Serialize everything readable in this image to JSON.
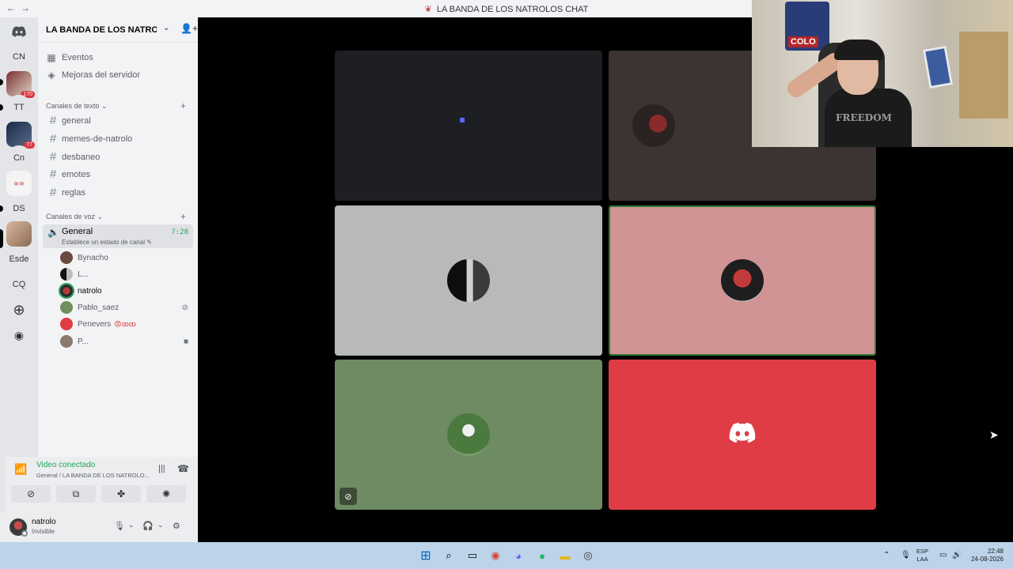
{
  "window": {
    "title": "LA BANDA DE LOS NATROLOS CHAT"
  },
  "guilds": [
    {
      "label": "CN"
    },
    {
      "label": "",
      "badge": "170"
    },
    {
      "label": "TT"
    },
    {
      "label": "",
      "badge": "77"
    },
    {
      "label": "Cn"
    },
    {
      "label": ""
    },
    {
      "label": "DS"
    },
    {
      "label": ""
    },
    {
      "label": "Esde"
    },
    {
      "label": "CQ"
    }
  ],
  "server": {
    "name": "LA BANDA DE LOS NATROL..."
  },
  "top_items": [
    {
      "label": "Eventos"
    },
    {
      "label": "Mejoras del servidor"
    }
  ],
  "text_category": "Canales de texto",
  "text_channels": [
    "general",
    "memes-de-natrolo",
    "desbaneo",
    "emotes",
    "reglas"
  ],
  "voice_category": "Canales de voz",
  "voice_channel": {
    "name": "General",
    "status": "Establece un estado de canal",
    "timer": "7:28"
  },
  "voice_users": [
    {
      "name": "Bynacho",
      "color": "#6b4a3e"
    },
    {
      "name": "L...",
      "color": "#222222"
    },
    {
      "name": "natrolo",
      "color": "#b23b3b"
    },
    {
      "name": "Pablo_saez",
      "color": "#6f8f5e"
    },
    {
      "name": "Penevers",
      "emoji": "😡ꝏꝏ",
      "color": "#e03c45"
    },
    {
      "name": "P...",
      "color": "#8b7a6f"
    }
  ],
  "voice_panel": {
    "title": "Video conectado",
    "subtitle": "General / LA BANDA DE LOS NATROLO..."
  },
  "user_panel": {
    "name": "natrolo",
    "status": "Invisible"
  },
  "tiles": [
    {
      "bg": "#1e1f22"
    },
    {
      "bg": "#3b3433"
    },
    {
      "bg": "#b8baba"
    },
    {
      "bg": "#d09494"
    },
    {
      "bg": "#6e8b64"
    },
    {
      "bg": "#e03c45"
    }
  ],
  "webcam": {
    "flag_text": "COLO",
    "shirt_text": "FREEDOM"
  },
  "taskbar": {
    "lang_top": "ESP",
    "lang_bottom": "LAA",
    "time": "22:48",
    "date": "24-08-2026"
  }
}
